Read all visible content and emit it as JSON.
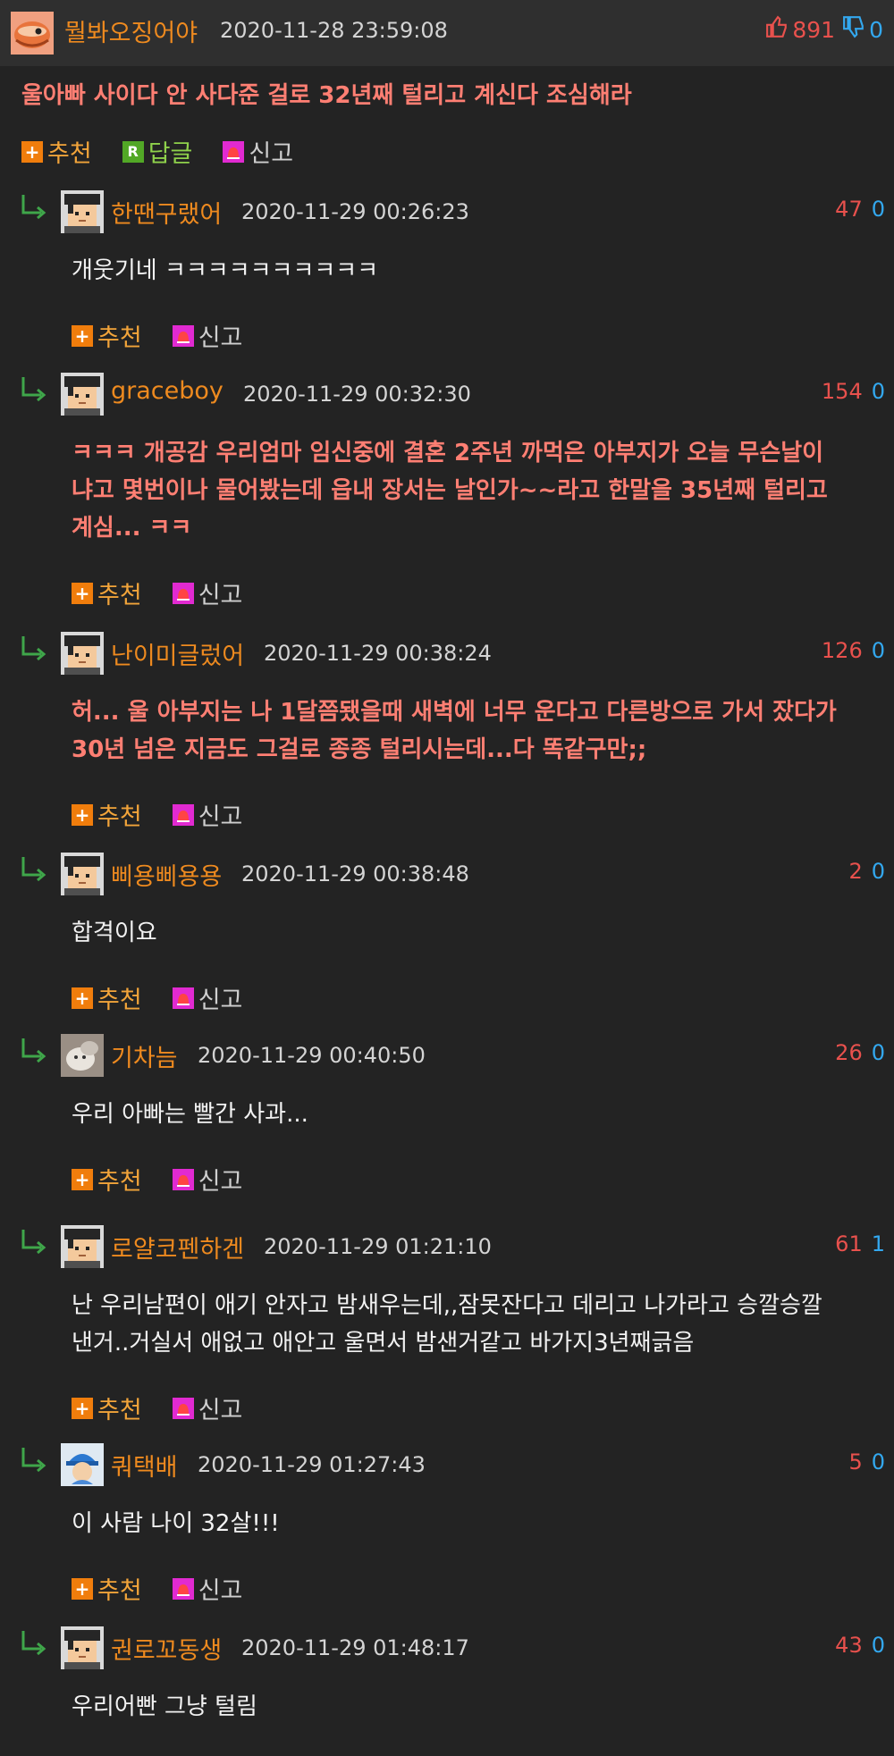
{
  "main_comment": {
    "nick": "뭘봐오징어야",
    "date": "2020-11-28 23:59:08",
    "up": "891",
    "down": "0",
    "text": "울아빠 사이다 안 사다준 걸로 32년째 털리고 계신다 조심해라",
    "actions": {
      "recommend": "추천",
      "reply": "답글",
      "report": "신고"
    }
  },
  "actions": {
    "recommend": "추천",
    "report": "신고"
  },
  "replies": [
    {
      "nick": "한땐구랬어",
      "date": "2020-11-29 00:26:23",
      "up": "47",
      "down": "0",
      "lines": [
        "개웃기네 ㅋㅋㅋㅋㅋㅋㅋㅋㅋㅋ"
      ],
      "hot": false,
      "avatar": "pixel"
    },
    {
      "nick": "graceboy",
      "date": "2020-11-29 00:32:30",
      "up": "154",
      "down": "0",
      "lines": [
        "ㅋㅋㅋ 개공감 우리엄마 임신중에 결혼 2주년 까먹은 아부지가 오늘 무슨날이",
        "냐고 몇번이나 물어봤는데 읍내 장서는 날인가~~라고 한말을 35년째 털리고",
        "계심... ㅋㅋ"
      ],
      "hot": true,
      "avatar": "pixel"
    },
    {
      "nick": "난이미글렀어",
      "date": "2020-11-29 00:38:24",
      "up": "126",
      "down": "0",
      "lines": [
        "허... 울 아부지는 나 1달쯤됐을때 새벽에 너무 운다고 다른방으로 가서 잤다가",
        "30년 넘은 지금도 그걸로 종종 털리시는데...다 똑같구만;;"
      ],
      "hot": true,
      "avatar": "pixel"
    },
    {
      "nick": "삐용삐용용",
      "date": "2020-11-29 00:38:48",
      "up": "2",
      "down": "0",
      "lines": [
        "합격이요"
      ],
      "hot": false,
      "avatar": "pixel"
    },
    {
      "nick": "기차늠",
      "date": "2020-11-29 00:40:50",
      "up": "26",
      "down": "0",
      "lines": [
        "우리 아빠는 빨간 사과..."
      ],
      "hot": false,
      "avatar": "cat"
    },
    {
      "nick": "로얄코펜하겐",
      "date": "2020-11-29 01:21:10",
      "up": "61",
      "down": "1",
      "lines": [
        "난 우리남편이 애기 안자고 밤새우는데,,잠못잔다고 데리고 나가라고 승깔승깔",
        "낸거..거실서 애없고 애안고 울면서 밤샌거같고 바가지3년째긁음"
      ],
      "hot": false,
      "avatar": "pixel"
    },
    {
      "nick": "쿼택배",
      "date": "2020-11-29 01:27:43",
      "up": "5",
      "down": "0",
      "lines": [
        "이 사람 나이 32살!!!"
      ],
      "hot": false,
      "avatar": "cap"
    },
    {
      "nick": "권로꼬동생",
      "date": "2020-11-29 01:48:17",
      "up": "43",
      "down": "0",
      "lines": [
        "우리어빤 그냥 털림"
      ],
      "hot": false,
      "avatar": "pixel"
    }
  ]
}
